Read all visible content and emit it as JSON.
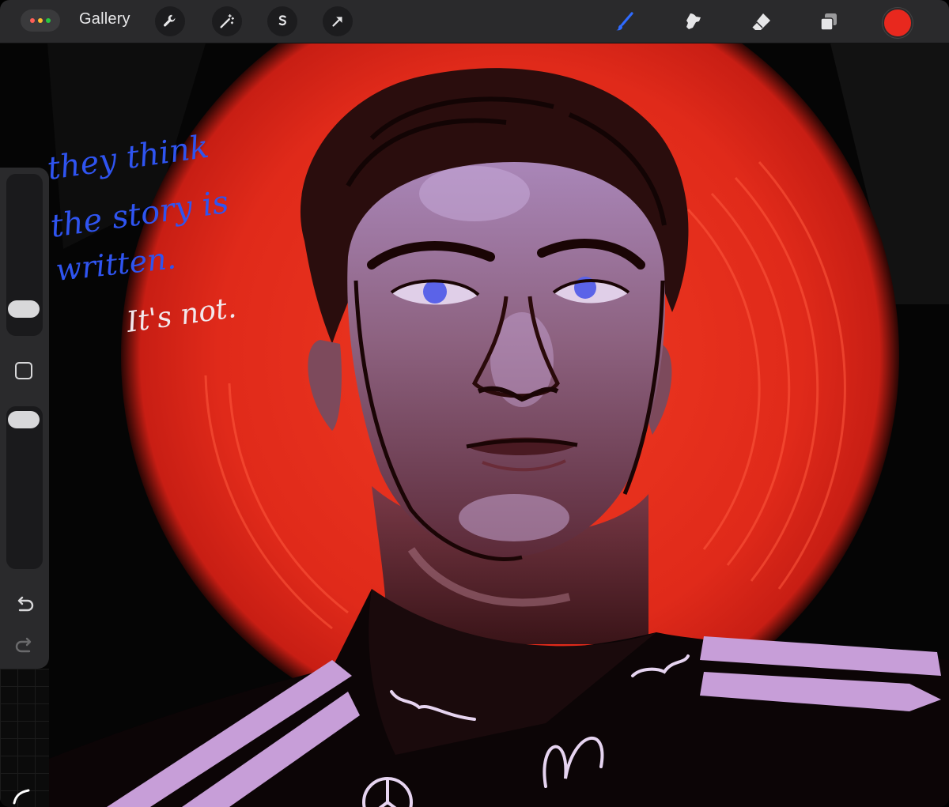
{
  "app": {
    "gallery_label": "Gallery",
    "accent_color": "#2f6bff",
    "active_color": "#e8281e"
  },
  "toolbar_left": [
    {
      "name": "actions-wrench-icon"
    },
    {
      "name": "adjustments-magic-wand-icon"
    },
    {
      "name": "selection-s-icon"
    },
    {
      "name": "transform-arrow-icon"
    }
  ],
  "toolbar_right": [
    {
      "name": "brush-icon",
      "active": true
    },
    {
      "name": "smudge-icon"
    },
    {
      "name": "eraser-icon"
    },
    {
      "name": "layers-icon"
    },
    {
      "name": "color-swatch"
    }
  ],
  "sidebar": {
    "brush_size_label": "",
    "opacity_label": ""
  },
  "artwork": {
    "handwriting_blue": [
      "they think",
      "the story is",
      "written."
    ],
    "handwriting_white": "It's not."
  }
}
